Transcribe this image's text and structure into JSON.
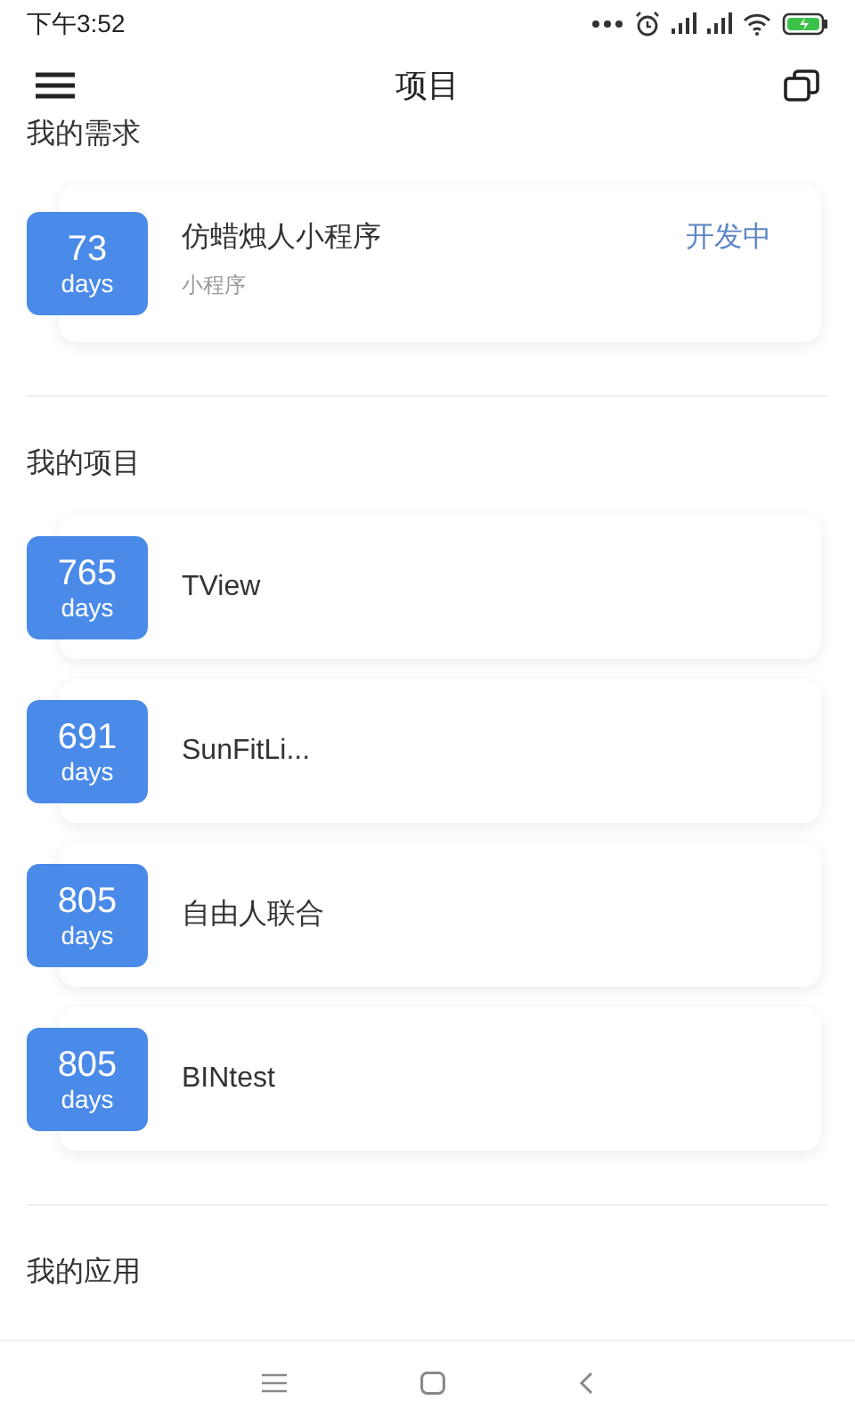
{
  "status_bar": {
    "time": "下午3:52"
  },
  "header": {
    "title": "项目"
  },
  "sections": [
    {
      "title": "我的需求",
      "items": [
        {
          "days": "73",
          "unit": "days",
          "name": "仿蜡烛人小程序",
          "subtitle": "小程序",
          "status": "开发中"
        }
      ]
    },
    {
      "title": "我的项目",
      "items": [
        {
          "days": "765",
          "unit": "days",
          "name": "TView"
        },
        {
          "days": "691",
          "unit": "days",
          "name": "SunFitLi..."
        },
        {
          "days": "805",
          "unit": "days",
          "name": "自由人联合"
        },
        {
          "days": "805",
          "unit": "days",
          "name": "BINtest"
        }
      ]
    },
    {
      "title": "我的应用"
    }
  ]
}
